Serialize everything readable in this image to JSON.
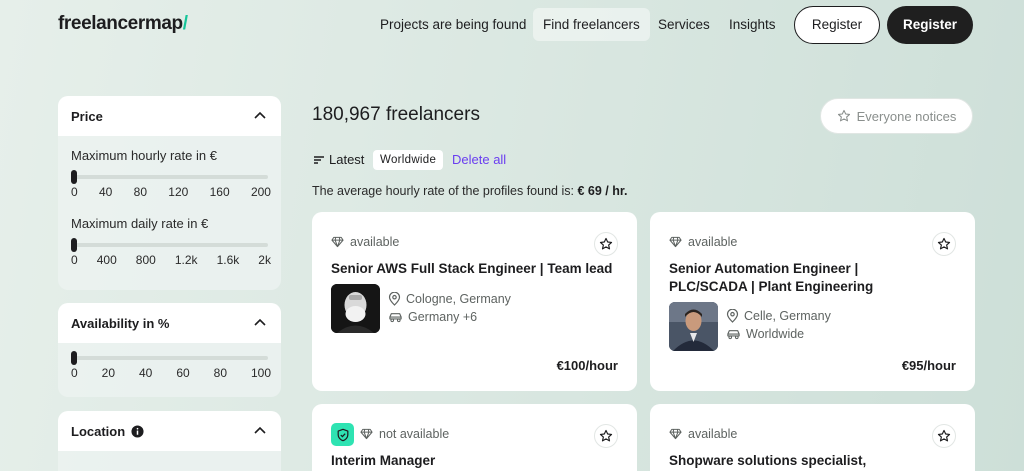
{
  "header": {
    "logo": "freelancermap",
    "logo_slash": "/",
    "nav": [
      "Projects are being found",
      "Find freelancers",
      "Services",
      "Insights"
    ],
    "register_outline": "Register",
    "register_dark": "Register"
  },
  "sidebar": {
    "price": {
      "title": "Price",
      "hourly_label": "Maximum hourly rate in €",
      "hourly_ticks": [
        "0",
        "40",
        "80",
        "120",
        "160",
        "200"
      ],
      "daily_label": "Maximum daily rate in €",
      "daily_ticks": [
        "0",
        "400",
        "800",
        "1.2k",
        "1.6k",
        "2k"
      ]
    },
    "availability": {
      "title": "Availability in %",
      "ticks": [
        "0",
        "20",
        "40",
        "60",
        "80",
        "100"
      ]
    },
    "location": {
      "title": "Location"
    }
  },
  "main": {
    "count": "180,967 freelancers",
    "notice_button": "Everyone notices",
    "sort_label": "Latest",
    "chip": "Worldwide",
    "delete_all": "Delete all",
    "avg_text": "The average hourly rate of the profiles found is:",
    "avg_value": "€ 69 / hr."
  },
  "cards": [
    {
      "status": "available",
      "title": "Senior AWS Full Stack Engineer | Team lead",
      "location": "Cologne, Germany",
      "remote": "Germany +6",
      "rate": "€100/hour"
    },
    {
      "status": "available",
      "title": "Senior Automation Engineer | PLC/SCADA | Plant Engineering",
      "location": "Celle, Germany",
      "remote": "Worldwide",
      "rate": "€95/hour"
    },
    {
      "status": "not available",
      "title": "Interim Manager"
    },
    {
      "status": "available",
      "title": "Shopware solutions specialist,"
    }
  ],
  "colors": {
    "accent": "#17c59a",
    "link": "#6a3ef0",
    "dark": "#1f1f1f"
  }
}
